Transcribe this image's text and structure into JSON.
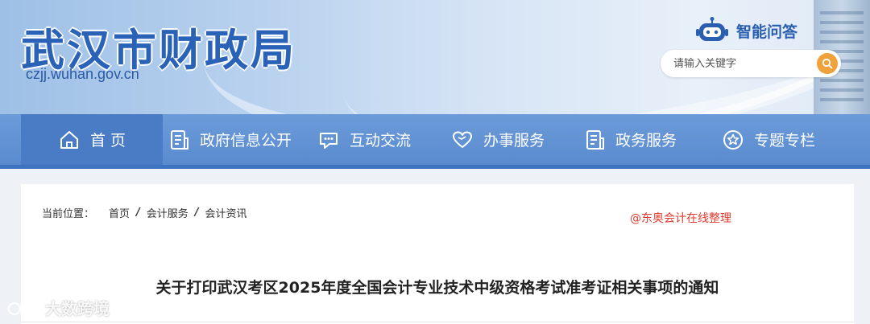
{
  "header": {
    "site_title": "武汉市财政局",
    "site_domain": "czjj.wuhan.gov.cn",
    "assistant_label": "智能问答",
    "search": {
      "placeholder": "请输入关键字",
      "value": ""
    }
  },
  "nav": {
    "items": [
      {
        "label": "首 页",
        "icon": "home-icon",
        "active": true
      },
      {
        "label": "政府信息公开",
        "icon": "document-icon",
        "active": false
      },
      {
        "label": "互动交流",
        "icon": "chat-icon",
        "active": false
      },
      {
        "label": "办事服务",
        "icon": "heart-icon",
        "active": false
      },
      {
        "label": "政务服务",
        "icon": "list-icon",
        "active": false
      },
      {
        "label": "专题专栏",
        "icon": "star-icon",
        "active": false
      }
    ]
  },
  "breadcrumb": {
    "prefix": "当前位置：",
    "items": [
      "首页",
      "会计服务",
      "会计资讯"
    ],
    "separator": "/"
  },
  "overlay_note": "@东奥会计在线整理",
  "article": {
    "title": "关于打印武汉考区2025年度全国会计专业技术中级资格考试准考证相关事项的通知"
  },
  "corner_watermark": "大数跨境",
  "colors": {
    "nav_bg": "#5a8bd0",
    "nav_active": "#4a7cc6",
    "title_blue": "#2a62b8",
    "search_button": "#f0a23a",
    "note_red": "#e03a2e"
  }
}
